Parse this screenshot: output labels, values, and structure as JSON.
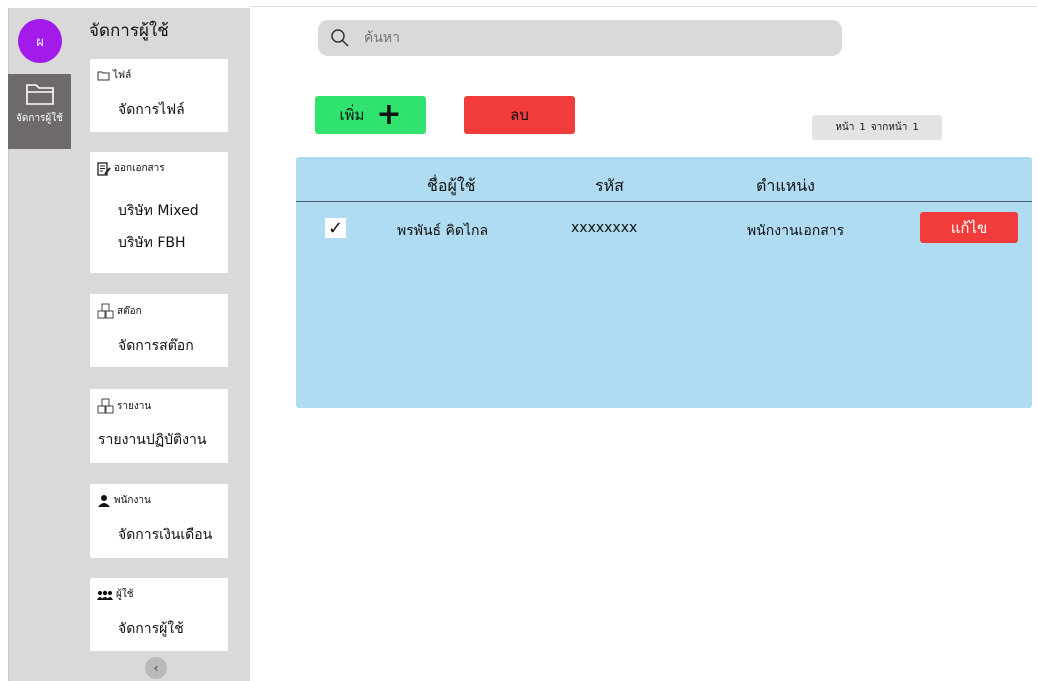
{
  "avatar": {
    "initial": "ผ",
    "color": "#a31bea"
  },
  "rail": {
    "item_label": "จัดการผู้ใช้",
    "item_icon": "folder-icon"
  },
  "panel": {
    "title": "จัดการผู้ใช้",
    "cards": [
      {
        "icon": "folder-icon",
        "header": "ไฟล์",
        "items": [
          "จัดการไฟล์"
        ]
      },
      {
        "icon": "document-edit-icon",
        "header": "ออกเอกสาร",
        "items": [
          "บริษัท Mixed",
          "บริษัท FBH"
        ]
      },
      {
        "icon": "boxes-icon",
        "header": "สต๊อก",
        "items": [
          "จัดการสต๊อก"
        ]
      },
      {
        "icon": "boxes-icon",
        "header": "รายงาน",
        "items": [
          "รายงานปฏิบัติงาน"
        ]
      },
      {
        "icon": "person-icon",
        "header": "พนักงาน",
        "items": [
          "จัดการเงินเดือน"
        ]
      },
      {
        "icon": "users-icon",
        "header": "ผู้ใช้",
        "items": [
          "จัดการผู้ใช้"
        ]
      }
    ],
    "collapse_glyph": "‹"
  },
  "search": {
    "placeholder": "ค้นหา",
    "value": ""
  },
  "toolbar": {
    "add_label": "เพิ่ม",
    "add_glyph": "+",
    "delete_label": "ลบ"
  },
  "pager": {
    "page_label": "หน้า",
    "page": "1",
    "of_label": "จากหน้า",
    "total": "1"
  },
  "table": {
    "headers": [
      "ชื่อผู้ใช้",
      "รหัส",
      "ตำแหน่ง"
    ],
    "rows": [
      {
        "checked": true,
        "check_glyph": "✓",
        "name": "พรพันธ์ คิดไกล",
        "code": "xxxxxxxx",
        "position": "พนักงานเอกสาร",
        "edit_label": "แก้ไข"
      }
    ]
  },
  "colors": {
    "add": "#2fe36e",
    "delete": "#f23b3b",
    "table_bg": "#afdcf2",
    "sidebar": "#d9d9d9",
    "rail_active": "#6e6a6a"
  }
}
